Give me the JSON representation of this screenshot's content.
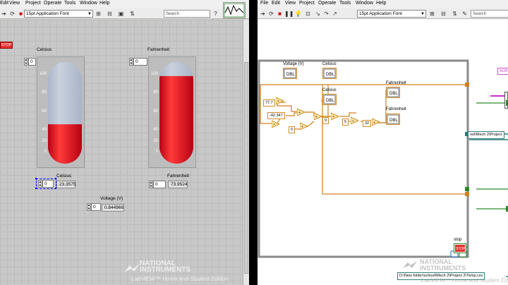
{
  "front_panel": {
    "menu": [
      "Edit",
      "View",
      "Project",
      "Operate",
      "Tools",
      "Window",
      "Help"
    ],
    "font_selector": "15pt Application Font",
    "search_placeholder": "Search",
    "stop_label": "STOP",
    "celsius_gauge": {
      "label": "Celsius",
      "fill_fraction": 0.23,
      "ticks": [
        "100",
        "80",
        "60",
        "40",
        "20",
        "0"
      ]
    },
    "fahrenheit_gauge": {
      "label": "Fahrenheit",
      "fill_fraction": 0.74,
      "ticks": [
        "100",
        "80",
        "60",
        "40",
        "20",
        "0"
      ]
    },
    "celsius_gauge_control": "0",
    "fahrenheit_gauge_control": "0",
    "celsius_indicator": {
      "label": "Celsius",
      "control": "0",
      "value": "23.3575"
    },
    "fahrenheit_indicator": {
      "label": "Fahrenheit",
      "control": "0",
      "value": "73.9524"
    },
    "voltage_indicator": {
      "label": "Voltage (V)",
      "control": "0",
      "value": "0.844966"
    },
    "watermark_line1": "NATIONAL",
    "watermark_line2": "INSTRUMENTS",
    "watermark_line3": "LabVIEW™ Home and Student Edition"
  },
  "block_diagram": {
    "menu": [
      "File",
      "Edit",
      "View",
      "Project",
      "Operate",
      "Tools",
      "Window",
      "Help"
    ],
    "font_selector": "15pt Application Font",
    "search_placeholder": "Search",
    "terminals": {
      "voltage": "Voltage (V)",
      "celsius_top": "Celsius",
      "celsius_mid": "Celsius",
      "fahrenheit_top": "Fahrenheit",
      "fahrenheit_mid": "Fahrenheit",
      "stop": "stop"
    },
    "constants": {
      "c1": "77.7",
      "c2": "-42.347",
      "c3": "0",
      "c4": "9",
      "c5": "5",
      "c6": "32"
    },
    "format_string": "%.5f",
    "path_partial": "ool\\Mech 2\\Project",
    "path_full": "D:\\New folder\\school\\Mech 2\\Project 2\\Temp.csv",
    "watermark_line1": "NATIONAL",
    "watermark_line2": "INSTRUMENTS",
    "watermark_line3": "LabVIEW™ Home and Student Edition"
  },
  "colors": {
    "gauge_red": "#e8001a",
    "gauge_gray": "#a9b4c8",
    "wire_orange": "#d2801a",
    "wire_pink": "#cc30cc",
    "wire_green": "#2a8a2a"
  }
}
